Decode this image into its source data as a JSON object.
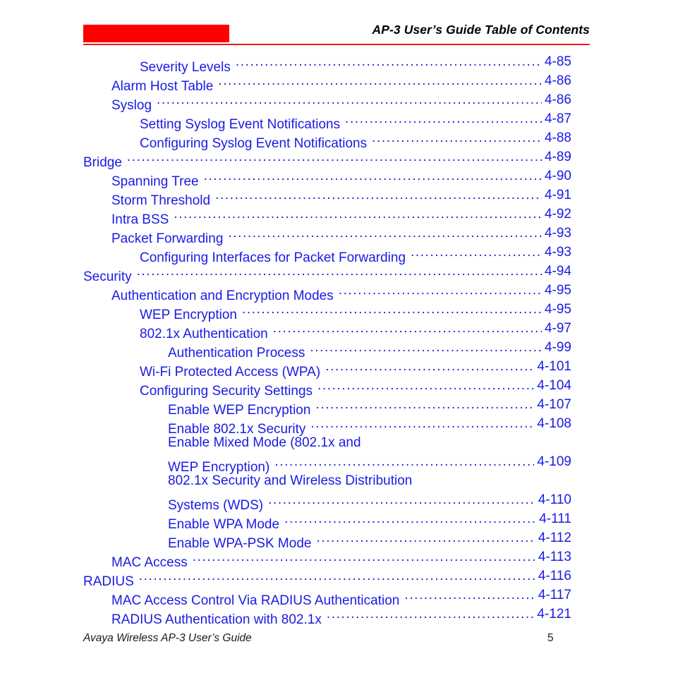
{
  "document": {
    "page_background": "#ffffff",
    "accent_red": "#fe0000",
    "rule_red": "#e81c1c",
    "link_blue": "#1a1ae6"
  },
  "header": {
    "title": "AP-3 User’s Guide Table of Contents",
    "logo_block_color": "#fe0000",
    "rule_color": "#e81c1c"
  },
  "toc": {
    "entries": [
      {
        "label": "Severity Levels",
        "page": "4-85",
        "level": 2,
        "leader": true
      },
      {
        "label": "Alarm Host Table",
        "page": "4-86",
        "level": 1,
        "leader": true
      },
      {
        "label": "Syslog",
        "page": "4-86",
        "level": 1,
        "leader": true
      },
      {
        "label": "Setting Syslog Event Notifications",
        "page": "4-87",
        "level": 2,
        "leader": true
      },
      {
        "label": "Configuring Syslog Event Notifications",
        "page": "4-88",
        "level": 2,
        "leader": true
      },
      {
        "label": "Bridge",
        "page": "4-89",
        "level": 0,
        "leader": true
      },
      {
        "label": "Spanning Tree",
        "page": "4-90",
        "level": 1,
        "leader": true
      },
      {
        "label": "Storm Threshold",
        "page": "4-91",
        "level": 1,
        "leader": true
      },
      {
        "label": "Intra BSS",
        "page": "4-92",
        "level": 1,
        "leader": true
      },
      {
        "label": "Packet Forwarding",
        "page": "4-93",
        "level": 1,
        "leader": true
      },
      {
        "label": "Configuring Interfaces for Packet Forwarding",
        "page": "4-93",
        "level": 2,
        "leader": true
      },
      {
        "label": "Security",
        "page": "4-94",
        "level": 0,
        "leader": true
      },
      {
        "label": "Authentication and Encryption Modes",
        "page": "4-95",
        "level": 1,
        "leader": true
      },
      {
        "label": "WEP Encryption",
        "page": "4-95",
        "level": 2,
        "leader": true
      },
      {
        "label": "802.1x Authentication",
        "page": "4-97",
        "level": 2,
        "leader": true
      },
      {
        "label": "Authentication Process",
        "page": "4-99",
        "level": 3,
        "leader": true
      },
      {
        "label": "Wi-Fi Protected Access (WPA)",
        "page": "4-101",
        "level": 2,
        "leader": true
      },
      {
        "label": "Configuring Security Settings",
        "page": "4-104",
        "level": 2,
        "leader": true
      },
      {
        "label": "Enable WEP Encryption",
        "page": "4-107",
        "level": 3,
        "leader": true
      },
      {
        "label": "Enable 802.1x Security",
        "page": "4-108",
        "level": 3,
        "leader": true
      },
      {
        "label": "Enable Mixed Mode (802.1x and",
        "page": "",
        "level": 3,
        "leader": false
      },
      {
        "label": "WEP Encryption)",
        "page": "4-109",
        "level": 3,
        "leader": true
      },
      {
        "label": "802.1x Security and Wireless Distribution",
        "page": "",
        "level": 3,
        "leader": false
      },
      {
        "label": "Systems (WDS)",
        "page": "4-110",
        "level": 3,
        "leader": true
      },
      {
        "label": "Enable WPA Mode",
        "page": "4-111",
        "level": 3,
        "leader": true
      },
      {
        "label": "Enable WPA-PSK Mode",
        "page": "4-112",
        "level": 3,
        "leader": true
      },
      {
        "label": "MAC Access",
        "page": "4-113",
        "level": 1,
        "leader": true
      },
      {
        "label": "RADIUS",
        "page": "4-116",
        "level": 0,
        "leader": true
      },
      {
        "label": "MAC Access Control Via RADIUS Authentication",
        "page": "4-117",
        "level": 1,
        "leader": true
      },
      {
        "label": "RADIUS Authentication with 802.1x",
        "page": "4-121",
        "level": 1,
        "leader": true
      }
    ]
  },
  "footer": {
    "text": "Avaya Wireless AP-3 User’s Guide",
    "page_number": "5"
  }
}
